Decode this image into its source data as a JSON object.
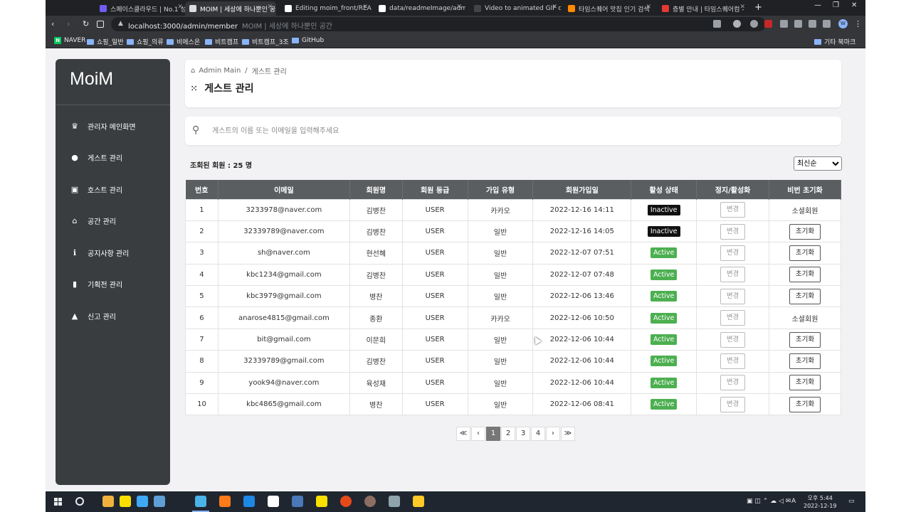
{
  "browser": {
    "tabs": [
      {
        "title": "스페이스클라우드 | No.1 성",
        "color": "#6f5df5"
      },
      {
        "title": "MOIM | 세상에 하나뿐인 공",
        "color": "#dddddd"
      },
      {
        "title": "Editing moim_front/READM",
        "color": "#ffffff"
      },
      {
        "title": "data/readmeImage/admin a",
        "color": "#ffffff"
      },
      {
        "title": "Video to animated GIF conv",
        "color": "#444444"
      },
      {
        "title": "타임스퀘어 맛집 인기 검색",
        "color": "#ff8a00"
      },
      {
        "title": "층별 안내 | 타임스퀘어컴 -",
        "color": "#e53935"
      }
    ],
    "new_tab": "+",
    "window_controls": [
      "—",
      "❐",
      "✕"
    ],
    "nav": {
      "back": "‹",
      "forward": "›",
      "reload": "↻"
    },
    "url": "localhost:3000/admin/member",
    "url_title": "MOIM | 세상에 하나뿐인 공간",
    "profile_initial": "W",
    "bookmarks": [
      {
        "label": "NAVER",
        "type": "naver"
      },
      {
        "label": "쇼핑_일반",
        "type": "folder"
      },
      {
        "label": "쇼핑_의류",
        "type": "folder"
      },
      {
        "label": "비에스온",
        "type": "folder"
      },
      {
        "label": "비트캠프",
        "type": "folder"
      },
      {
        "label": "비트캠프_3조",
        "type": "folder"
      },
      {
        "label": "GitHub",
        "type": "folder"
      }
    ],
    "other_bookmarks": "기타 북마크"
  },
  "sidebar": {
    "logo": "MoiM",
    "items": [
      {
        "label": "관리자 메인화면",
        "icon": "crown-icon",
        "glyph": "♛"
      },
      {
        "label": "게스트 관리",
        "icon": "user-circle-icon",
        "glyph": "●"
      },
      {
        "label": "호스트 관리",
        "icon": "id-card-icon",
        "glyph": "▣"
      },
      {
        "label": "공간 관리",
        "icon": "building-icon",
        "glyph": "⌂"
      },
      {
        "label": "공지사항 관리",
        "icon": "info-icon",
        "glyph": "ℹ"
      },
      {
        "label": "기획전 관리",
        "icon": "ticket-icon",
        "glyph": "▮"
      },
      {
        "label": "신고 관리",
        "icon": "warning-icon",
        "glyph": "▲"
      }
    ]
  },
  "header": {
    "breadcrumb_home": "Admin Main",
    "breadcrumb_sep": "/",
    "breadcrumb_current": "게스트 관리",
    "title": "게스트 관리"
  },
  "search": {
    "placeholder": "게스트의 이름 또는 이메일을 입력해주세요",
    "value": ""
  },
  "summary": {
    "count_text": "조회된 회원 : 25 명"
  },
  "sort": {
    "selected": "최신순"
  },
  "table": {
    "columns": [
      "번호",
      "이메일",
      "회원명",
      "회원 등급",
      "가입 유형",
      "회원가입일",
      "활성 상태",
      "정지/활성화",
      "비번 초기화"
    ],
    "rows": [
      {
        "no": "1",
        "email": "3233978@naver.com",
        "name": "김병찬",
        "grade": "USER",
        "type": "카카오",
        "joined": "2022-12-16 14:11",
        "status": "Inactive",
        "action": "변경",
        "reset": "소셜회원",
        "reset_is_button": false
      },
      {
        "no": "2",
        "email": "32339789@naver.com",
        "name": "김병찬",
        "grade": "USER",
        "type": "일반",
        "joined": "2022-12-16 14:05",
        "status": "Inactive",
        "action": "변경",
        "reset": "초기화",
        "reset_is_button": true
      },
      {
        "no": "3",
        "email": "sh@naver.com",
        "name": "현선혜",
        "grade": "USER",
        "type": "일반",
        "joined": "2022-12-07 07:51",
        "status": "Active",
        "action": "변경",
        "reset": "초기화",
        "reset_is_button": true
      },
      {
        "no": "4",
        "email": "kbc1234@gmail.com",
        "name": "김병찬",
        "grade": "USER",
        "type": "일반",
        "joined": "2022-12-07 07:48",
        "status": "Active",
        "action": "변경",
        "reset": "초기화",
        "reset_is_button": true
      },
      {
        "no": "5",
        "email": "kbc3979@gmail.com",
        "name": "병찬",
        "grade": "USER",
        "type": "일반",
        "joined": "2022-12-06 13:46",
        "status": "Active",
        "action": "변경",
        "reset": "초기화",
        "reset_is_button": true
      },
      {
        "no": "6",
        "email": "anarose4815@gmail.com",
        "name": "종환",
        "grade": "USER",
        "type": "카카오",
        "joined": "2022-12-06 10:50",
        "status": "Active",
        "action": "변경",
        "reset": "소셜회원",
        "reset_is_button": false
      },
      {
        "no": "7",
        "email": "bit@gmail.com",
        "name": "이문희",
        "grade": "USER",
        "type": "일반",
        "joined": "2022-12-06 10:44",
        "status": "Active",
        "action": "변경",
        "reset": "초기화",
        "reset_is_button": true
      },
      {
        "no": "8",
        "email": "32339789@gmail.com",
        "name": "김병찬",
        "grade": "USER",
        "type": "일반",
        "joined": "2022-12-06 10:44",
        "status": "Active",
        "action": "변경",
        "reset": "초기화",
        "reset_is_button": true
      },
      {
        "no": "9",
        "email": "yook94@naver.com",
        "name": "육성재",
        "grade": "USER",
        "type": "일반",
        "joined": "2022-12-06 10:44",
        "status": "Active",
        "action": "변경",
        "reset": "초기화",
        "reset_is_button": true
      },
      {
        "no": "10",
        "email": "kbc4865@gmail.com",
        "name": "병찬",
        "grade": "USER",
        "type": "일반",
        "joined": "2022-12-06 08:41",
        "status": "Active",
        "action": "변경",
        "reset": "초기화",
        "reset_is_button": true
      }
    ]
  },
  "pagination": {
    "first": "≪",
    "prev": "‹",
    "pages": [
      "1",
      "2",
      "3",
      "4"
    ],
    "current": "1",
    "next": "›",
    "last": "≫"
  },
  "taskbar": {
    "time": "오후 5:44",
    "date": "2022-12-19",
    "lang": "A"
  },
  "colors": {
    "sidebar_bg": "#3a3d3f",
    "table_header_bg": "#5b5e61",
    "active_badge": "#4caf50",
    "inactive_badge": "#111111"
  }
}
